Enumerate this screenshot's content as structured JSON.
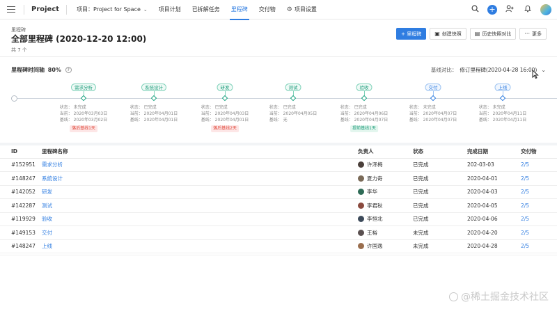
{
  "topnav": {
    "app_title": "Project",
    "project_label": "项目：Project for Space",
    "items": [
      "项目计划",
      "已拆解任务",
      "里程碑",
      "交付物",
      "项目设置"
    ],
    "active_index": 2
  },
  "header": {
    "breadcrumb": "里程碑",
    "title": "全部里程碑 (2020-12-20 12:00)",
    "count": "共 7 个",
    "actions": {
      "add": "+ 里程碑",
      "snapshot": "创建快照",
      "history_compare": "历史快照对比",
      "more": "更多"
    }
  },
  "timeline": {
    "title": "里程碑时间轴",
    "percent": "80%",
    "baseline_label": "基线对比：",
    "baseline_value": "修订里程碑(2020-04-28 16:00)",
    "milestones": [
      {
        "name": "需求分析",
        "status": "状态：  未完成",
        "current": "当前：  2020年03月03日",
        "baseline": "基线：  2020年03月02日",
        "badge": "落后基线1天",
        "badge_type": "late",
        "color": "green"
      },
      {
        "name": "系统设计",
        "status": "状态：  已完成",
        "current": "当前：  2020年04月01日",
        "baseline": "基线：  2020年04月01日",
        "badge": "",
        "badge_type": "",
        "color": "green"
      },
      {
        "name": "研发",
        "status": "状态：  已完成",
        "current": "当前：  2020年04月03日",
        "baseline": "基线：  2020年04月01日",
        "badge": "落后基线2天",
        "badge_type": "late",
        "color": "green"
      },
      {
        "name": "测试",
        "status": "状态：  已完成",
        "current": "当前：  2020年04月05日",
        "baseline": "基线：  无",
        "badge": "",
        "badge_type": "",
        "color": "green"
      },
      {
        "name": "验收",
        "status": "状态：  已完成",
        "current": "当前：  2020年04月06日",
        "baseline": "基线：  2020年04月07日",
        "badge": "提前基线1天",
        "badge_type": "early",
        "color": "green"
      },
      {
        "name": "交付",
        "status": "状态：  未完成",
        "current": "当前：  2020年04月07日",
        "baseline": "基线：  2020年04月07日",
        "badge": "",
        "badge_type": "",
        "color": "blue"
      },
      {
        "name": "上线",
        "status": "状态：  未完成",
        "current": "当前：  2020年04月11日",
        "baseline": "基线：  2020年04月11日",
        "badge": "",
        "badge_type": "",
        "color": "blue"
      }
    ]
  },
  "table": {
    "headers": [
      "ID",
      "里程碑名称",
      "负责人",
      "状态",
      "完成日期",
      "交付物"
    ],
    "rows": [
      {
        "id": "#152951",
        "name": "需求分析",
        "owner": "许泽梅",
        "status": "已完成",
        "date": "202-03-03",
        "deliverables": "2/5"
      },
      {
        "id": "#148247",
        "name": "系统设计",
        "owner": "夏力奇",
        "status": "已完成",
        "date": "2020-04-01",
        "deliverables": "2/5"
      },
      {
        "id": "#142052",
        "name": "研发",
        "owner": "李华",
        "status": "已完成",
        "date": "2020-04-03",
        "deliverables": "2/5"
      },
      {
        "id": "#142287",
        "name": "测试",
        "owner": "李君秋",
        "status": "已完成",
        "date": "2020-04-05",
        "deliverables": "2/5"
      },
      {
        "id": "#119929",
        "name": "验收",
        "owner": "李恒北",
        "status": "已完成",
        "date": "2020-04-06",
        "deliverables": "2/5"
      },
      {
        "id": "#149153",
        "name": "交付",
        "owner": "王裕",
        "status": "未完成",
        "date": "2020-04-20",
        "deliverables": "2/5"
      },
      {
        "id": "#148247",
        "name": "上线",
        "owner": "许国逸",
        "status": "未完成",
        "date": "2020-04-28",
        "deliverables": "2/5"
      }
    ]
  },
  "watermark": "@稀土掘金技术社区",
  "colors": {
    "accent": "#2f7de1",
    "done_green": "#1a9b7a",
    "late_red": "#e0483b"
  }
}
